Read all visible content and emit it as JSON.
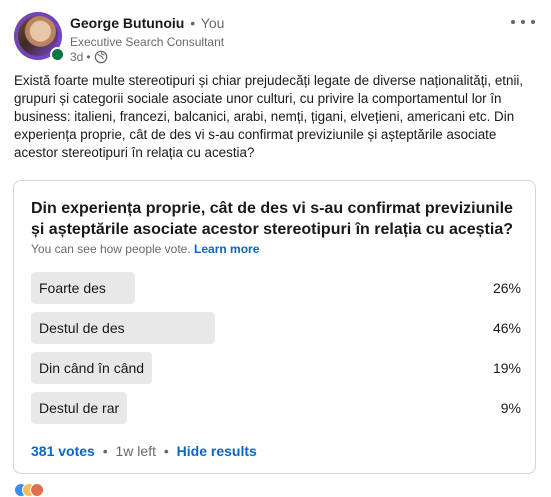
{
  "author": {
    "name": "George Butunoiu",
    "relation": "You",
    "headline": "Executive Search Consultant",
    "posted": "3d"
  },
  "post": {
    "text": "Există foarte multe stereotipuri și chiar prejudecăți legate de diverse naționalități, etnii, grupuri și categorii sociale asociate unor culturi, cu privire la comportamentul lor în business: italieni, francezi, balcanici, arabi, nemți, țigani, elvețieni, americani etc. Din experiența proprie, cât de des vi s-au confirmat previziunile și așteptările asociate acestor stereotipuri în relația cu acestia?"
  },
  "poll": {
    "question": "Din experiența proprie, cât de des vi s-au confirmat previziunile și așteptările asociate acestor stereotipuri în relația cu aceștia?",
    "note": "You can see how people vote.",
    "learn_more": "Learn more",
    "options": [
      {
        "label": "Foarte des",
        "percent_text": "26%",
        "percent": 26
      },
      {
        "label": "Destul de des",
        "percent_text": "46%",
        "percent": 46
      },
      {
        "label": "Din când în când",
        "percent_text": "19%",
        "percent": 19
      },
      {
        "label": "Destul de rar",
        "percent_text": "9%",
        "percent": 9
      }
    ],
    "votes": "381 votes",
    "time_left": "1w left",
    "hide_results": "Hide results"
  },
  "colors": {
    "link": "#0a66c2",
    "online": "#057642",
    "bar": "#e8e8e8"
  },
  "icons": [
    "more-options-icon",
    "globe-icon",
    "online-status-icon"
  ]
}
